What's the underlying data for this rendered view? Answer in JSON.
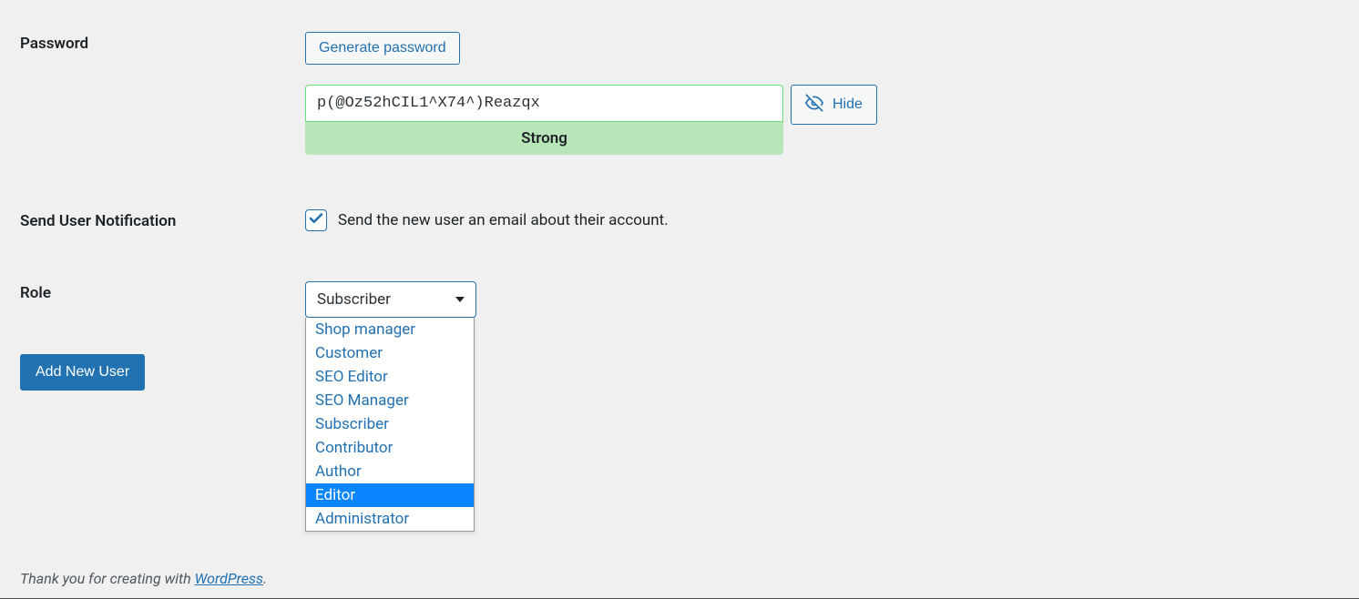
{
  "password": {
    "label": "Password",
    "generate_button": "Generate password",
    "value": "p(@Oz52hCIL1^X74^)Reazqx",
    "strength": "Strong",
    "hide_button": "Hide"
  },
  "notification": {
    "label": "Send User Notification",
    "checked": true,
    "description": "Send the new user an email about their account."
  },
  "role": {
    "label": "Role",
    "selected": "Subscriber",
    "options": [
      "Shop manager",
      "Customer",
      "SEO Editor",
      "SEO Manager",
      "Subscriber",
      "Contributor",
      "Author",
      "Editor",
      "Administrator"
    ],
    "highlighted_index": 7
  },
  "submit": {
    "label": "Add New User"
  },
  "footer": {
    "prefix": "Thank you for creating with ",
    "link_text": "WordPress",
    "suffix": "."
  }
}
